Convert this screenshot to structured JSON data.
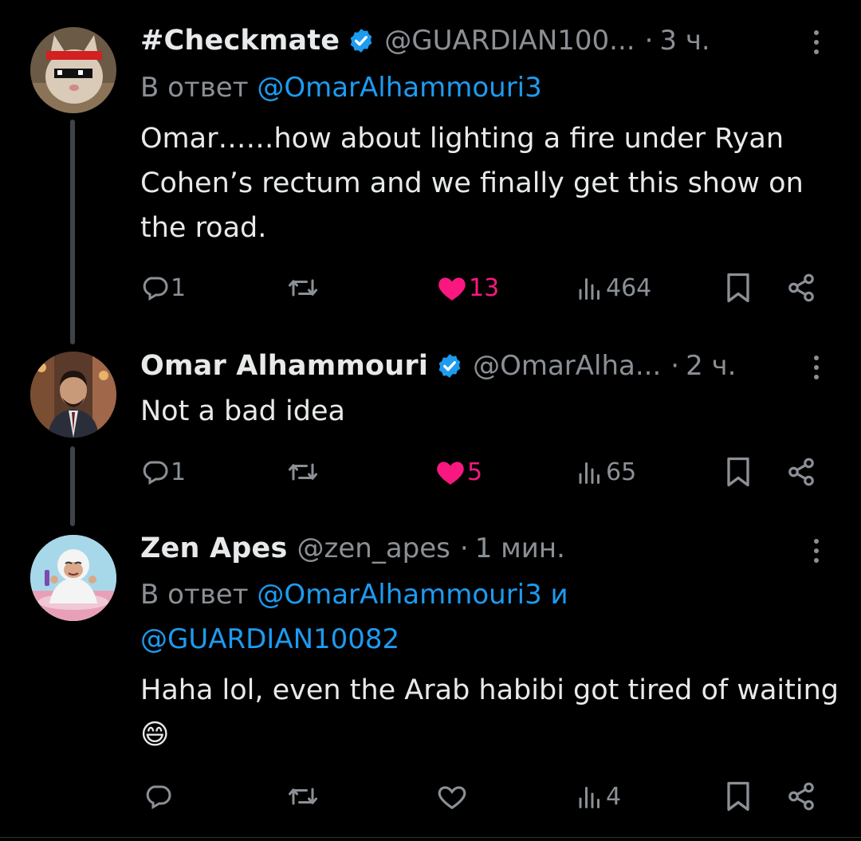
{
  "tweets": [
    {
      "name": "#Checkmate",
      "handle": "@GUARDIAN100...",
      "dot": "·",
      "time": "3 ч.",
      "reply_prefix": "В ответ ",
      "reply_to_1": "@OmarAlhammouri3",
      "reply_join": "",
      "reply_to_2": "",
      "text": "Omar……how about lighting a fire under Ryan Cohen’s rectum and we finally get this show on the road.",
      "replies": "1",
      "retweets": "",
      "likes": "13",
      "liked": true,
      "views": "464",
      "avatar_icon": "cat-avatar-icon"
    },
    {
      "name": "Omar Alhammouri",
      "handle": "@OmarAlha...",
      "dot": "·",
      "time": "2 ч.",
      "text": "Not a bad idea",
      "replies": "1",
      "retweets": "",
      "likes": "5",
      "liked": true,
      "views": "65",
      "avatar_icon": "person-avatar-icon"
    },
    {
      "name": "Zen Apes",
      "handle": "@zen_apes",
      "dot": "·",
      "time": "1 мин.",
      "reply_prefix": "В ответ ",
      "reply_to_1": "@OmarAlhammouri3",
      "reply_join": " и ",
      "reply_to_2": "@GUARDIAN10082",
      "text": "Haha lol, even the Arab habibi got tired of waiting",
      "emoji": "😄",
      "replies": "",
      "retweets": "",
      "likes": "",
      "liked": false,
      "views": "4",
      "avatar_icon": "ape-avatar-icon"
    }
  ],
  "colors": {
    "background": "#000000",
    "text": "#e7e9ea",
    "muted": "#8b9096",
    "link": "#1d9bf0",
    "like": "#f91880",
    "verified": "#1d9bf0"
  }
}
